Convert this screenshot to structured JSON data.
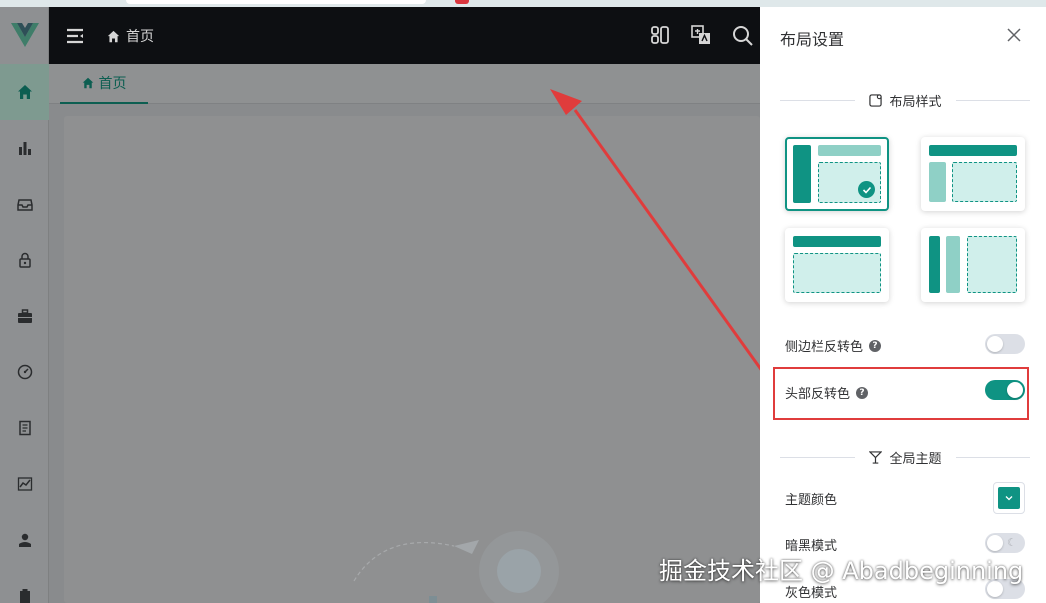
{
  "header": {
    "breadcrumb": "首页"
  },
  "tabs": [
    {
      "label": "首页"
    }
  ],
  "drawer": {
    "title": "布局设置",
    "layout_section": "布局样式",
    "layout_options": [
      {
        "name": "vertical",
        "selected": true
      },
      {
        "name": "classic",
        "selected": false
      },
      {
        "name": "transverse",
        "selected": false
      },
      {
        "name": "columns",
        "selected": false
      }
    ],
    "sidebar_inverted": {
      "label": "侧边栏反转色",
      "on": false
    },
    "header_inverted": {
      "label": "头部反转色",
      "on": true
    },
    "theme_section": "全局主题",
    "theme_color": {
      "label": "主题颜色",
      "value": "#0f9383"
    },
    "dark_mode": {
      "label": "暗黑模式",
      "on": false
    },
    "gray_mode": {
      "label": "灰色模式",
      "on": false
    }
  },
  "colors": {
    "primary": "#0f9383",
    "header_bg": "#0d0f12",
    "annotation": "#e03c3c"
  },
  "watermark": "掘金技术社区 @ Abadbeginning"
}
